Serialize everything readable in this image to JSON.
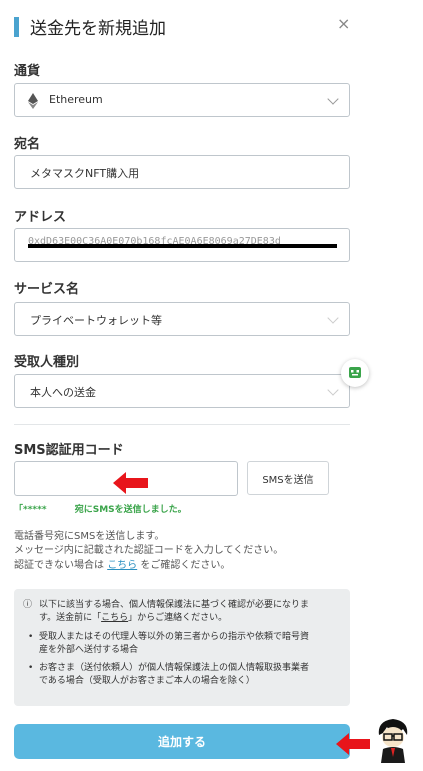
{
  "title": "送金先を新規追加",
  "close": "×",
  "currency": {
    "label": "通貨",
    "value": "Ethereum"
  },
  "name": {
    "label": "宛名",
    "value": "メタマスクNFT購入用"
  },
  "address": {
    "label": "アドレス",
    "value": "0xdD63E00C36A0E070b168fcAE0A6E8069a27DE83d"
  },
  "service": {
    "label": "サービス名",
    "value": "プライベートウォレット等"
  },
  "recipient_type": {
    "label": "受取人種別",
    "value": "本人への送金"
  },
  "sms": {
    "label": "SMS認証用コード",
    "input_value": "",
    "send_button": "SMSを送信",
    "sent_message": "「*****         宛にSMSを送信しました。"
  },
  "info": {
    "line1": "電話番号宛にSMSを送信します。",
    "line2": "メッセージ内に記載された認証コードを入力してください。",
    "line3_prefix": "認証できない場合は",
    "line3_link": "こちら",
    "line3_suffix": "をご確認ください。"
  },
  "notice": {
    "icon": "ⓘ",
    "line1": "以下に該当する場合、個人情報保護法に基づく確認が必要になりま",
    "line2_prefix": "す。送金前に「",
    "line2_link": "こちら",
    "line2_suffix": "」からご連絡ください。",
    "bullet1_line1": "受取人またはその代理人等以外の第三者からの指示や依頼で暗号資",
    "bullet1_line2": "産を外部へ送付する場合",
    "bullet2_line1": "お客さま（送付依頼人）が個人情報保護法上の個人情報取扱事業者",
    "bullet2_line2": "である場合（受取人がお客さまご本人の場合を除く）"
  },
  "submit_label": "追加する",
  "colors": {
    "accent": "#4aa3cf",
    "button": "#5ab8e0",
    "success": "#3aa44a",
    "arrow": "#e8151b"
  }
}
